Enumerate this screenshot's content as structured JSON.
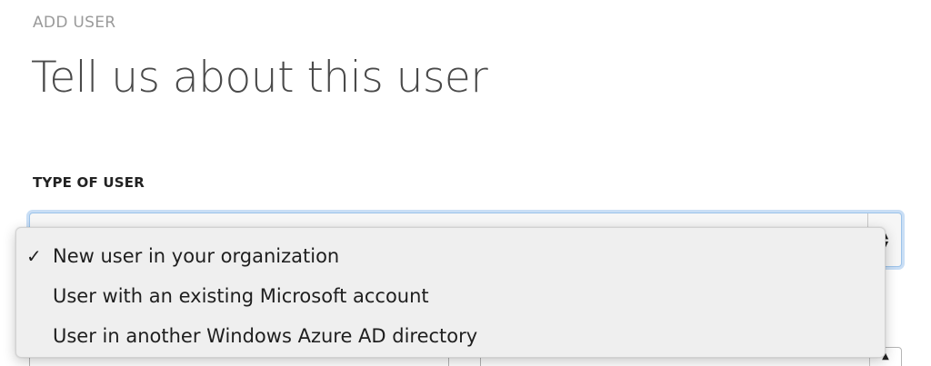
{
  "header": {
    "step_label": "ADD USER",
    "title": "Tell us about this user"
  },
  "type_of_user": {
    "label": "TYPE OF USER",
    "options": [
      {
        "label": "New user in your organization",
        "selected": true
      },
      {
        "label": "User with an existing Microsoft account",
        "selected": false
      },
      {
        "label": "User in another Windows Azure AD directory",
        "selected": false
      }
    ],
    "check_glyph": "✓"
  },
  "icons": {
    "select_arrows": "up-down-chevron-icon"
  },
  "colors": {
    "focus_ring": "#9cc3ea",
    "menu_background": "#efefef",
    "title_text": "#4a4a4a",
    "step_label_text": "#9a9a9a"
  }
}
